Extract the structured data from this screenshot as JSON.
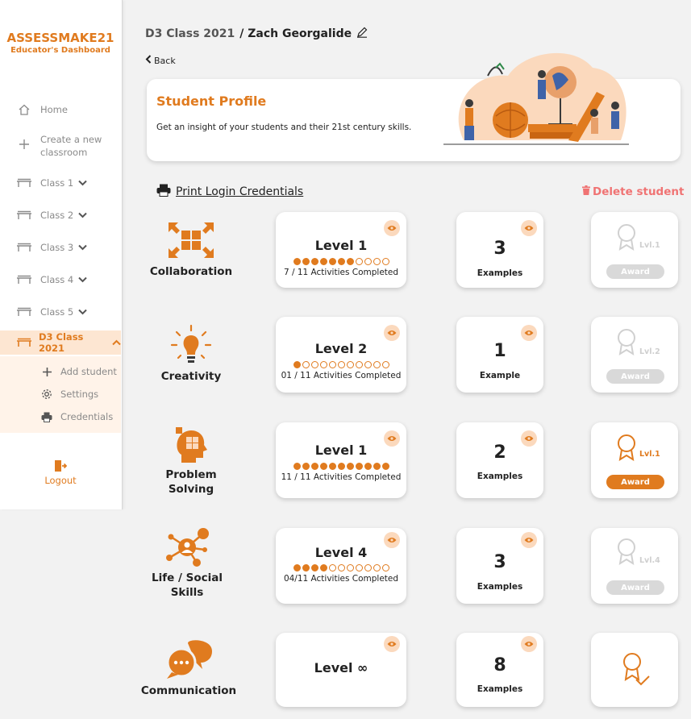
{
  "brand": {
    "title": "ASSESSMAKE21",
    "subtitle": "Educator's Dashboard"
  },
  "sidebar": {
    "home": "Home",
    "create_line1": "Create a new",
    "create_line2": "classroom",
    "classes": [
      "Class 1",
      "Class 2",
      "Class 3",
      "Class 4",
      "Class 5"
    ],
    "active_class": "D3 Class 2021",
    "sub_items": [
      "Add student",
      "Settings",
      "Credentials"
    ],
    "logout": "Logout"
  },
  "header": {
    "class_name": "D3 Class 2021",
    "student": "/ Zach Georgalide",
    "back": "Back"
  },
  "profile": {
    "title": "Student Profile",
    "description": "Get an insight of your students and their 21st century skills."
  },
  "actions": {
    "print": "Print Login Credentials",
    "delete": "Delete student"
  },
  "rows": [
    {
      "skill_1": "Collaboration",
      "skill_2": "",
      "level": "Level 1",
      "done": 7,
      "total": 11,
      "activities": "7 / 11 Activities Completed",
      "examples": "3",
      "examples_label": "Examples",
      "award_level": "Lvl.1",
      "award_button": "Award",
      "award_active": false
    },
    {
      "skill_1": "Creativity",
      "skill_2": "",
      "level": "Level 2",
      "done": 1,
      "total": 11,
      "activities": "01 / 11 Activities Completed",
      "examples": "1",
      "examples_label": "Example",
      "award_level": "Lvl.2",
      "award_button": "Award",
      "award_active": false
    },
    {
      "skill_1": "Problem",
      "skill_2": "Solving",
      "level": "Level 1",
      "done": 11,
      "total": 11,
      "activities": "11 / 11 Activities Completed",
      "examples": "2",
      "examples_label": "Examples",
      "award_level": "Lvl.1",
      "award_button": "Award",
      "award_active": true
    },
    {
      "skill_1": "Life / Social",
      "skill_2": "Skills",
      "level": "Level 4",
      "done": 4,
      "total": 11,
      "activities": "04/11 Activities Completed",
      "examples": "3",
      "examples_label": "Examples",
      "award_level": "Lvl.4",
      "award_button": "Award",
      "award_active": false
    },
    {
      "skill_1": "Communication",
      "skill_2": "",
      "level": "Level ∞",
      "done": 0,
      "total": 0,
      "activities": "",
      "examples": "8",
      "examples_label": "Examples",
      "award_level": "",
      "award_button": "",
      "award_active": false,
      "award_done": true
    }
  ],
  "colors": {
    "accent": "#e07b1f",
    "accent_light": "#fbd9bd",
    "danger": "#f07373",
    "muted": "#d9d9d9"
  }
}
